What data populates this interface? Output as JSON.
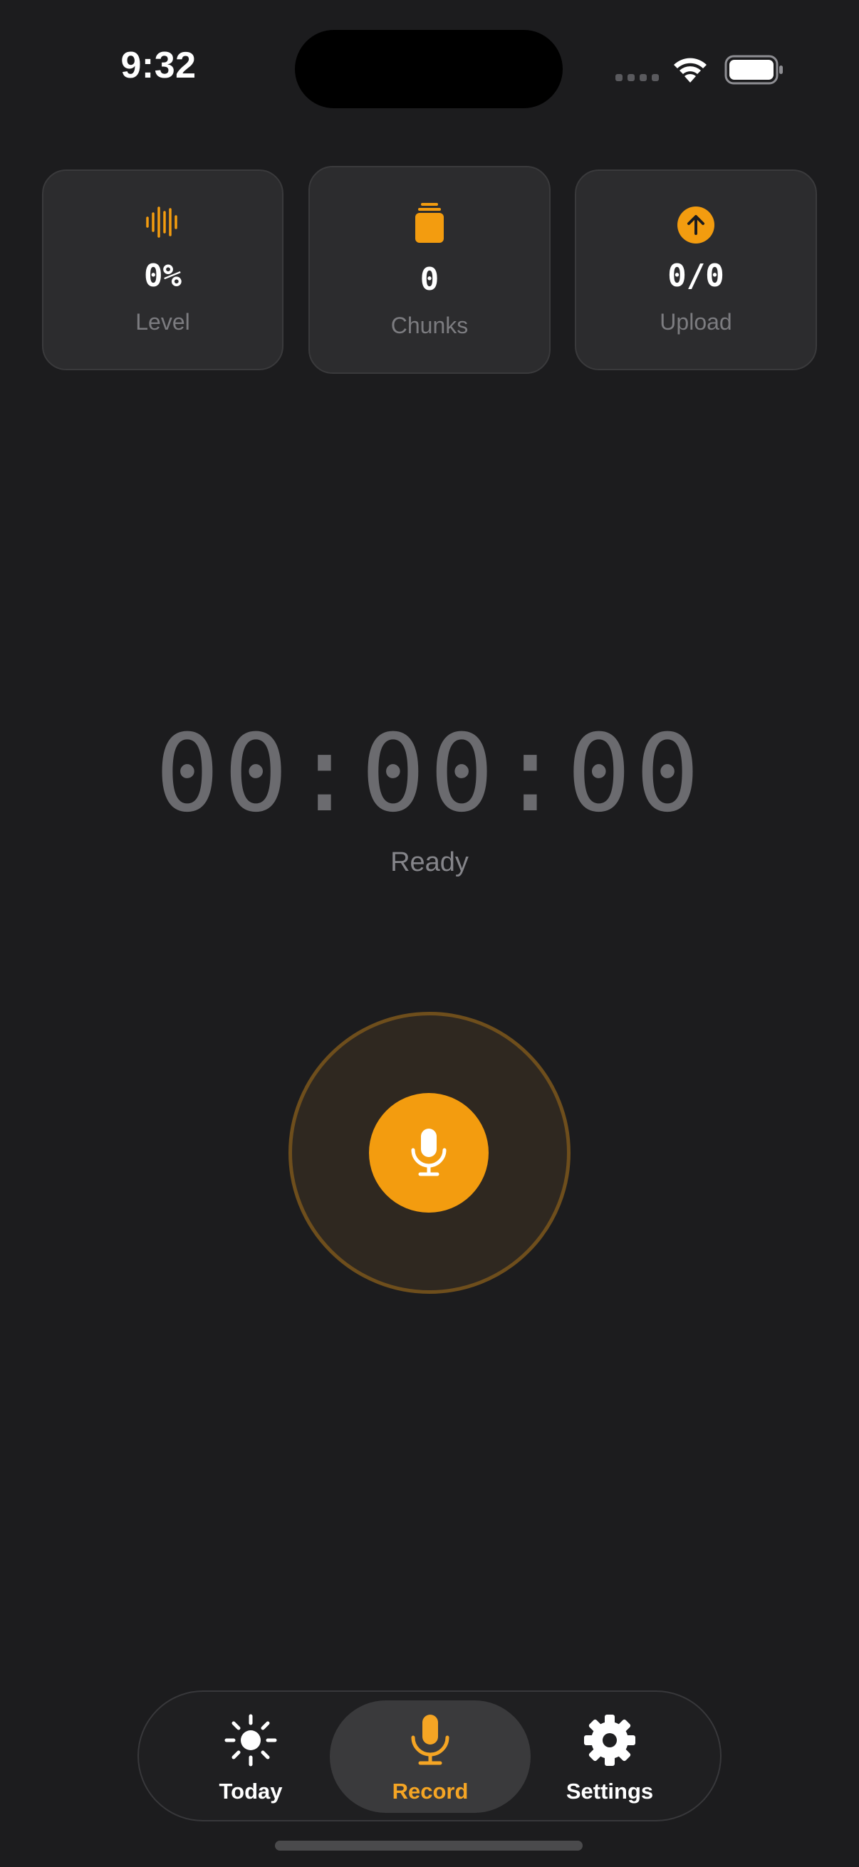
{
  "status_bar": {
    "time": "9:32"
  },
  "colors": {
    "accent": "#F39C0F",
    "background": "#1C1C1E",
    "card": "#2C2C2E"
  },
  "stats": [
    {
      "icon": "waveform-icon",
      "value": "0%",
      "label": "Level"
    },
    {
      "icon": "stack-icon",
      "value": "0",
      "label": "Chunks"
    },
    {
      "icon": "arrow-up-circle-icon",
      "value": "0/0",
      "label": "Upload"
    }
  ],
  "recorder": {
    "timer": "00:00:00",
    "status": "Ready",
    "button_icon": "microphone-icon"
  },
  "tab_bar": {
    "selected": "Record",
    "tabs": [
      {
        "icon": "sun-icon",
        "label": "Today"
      },
      {
        "icon": "microphone-icon",
        "label": "Record"
      },
      {
        "icon": "gear-icon",
        "label": "Settings"
      }
    ]
  }
}
